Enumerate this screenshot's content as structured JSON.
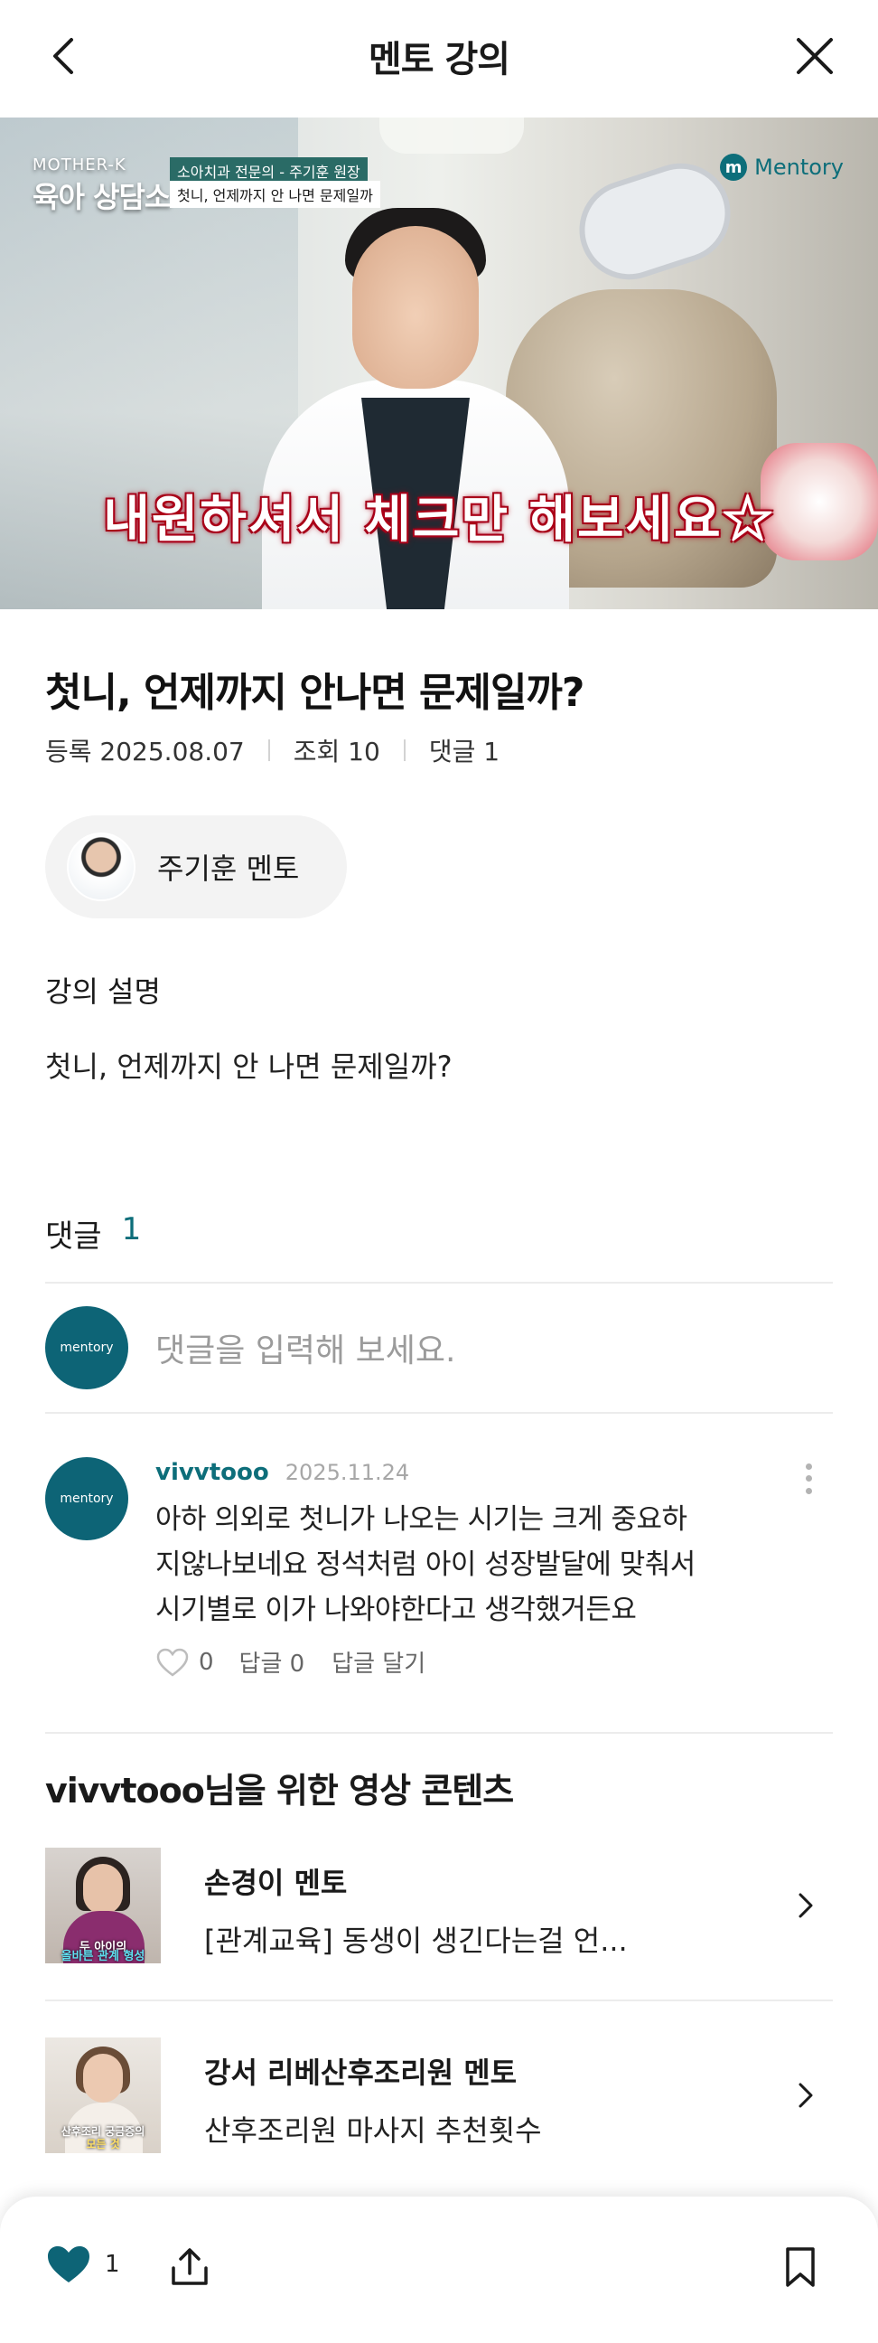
{
  "header": {
    "title": "멘토 강의"
  },
  "video": {
    "brand_small": "MOTHER-K",
    "brand_big": "육아 상담소",
    "caption_line1": "소아치과 전문의 - 주기훈 원장",
    "caption_line2": "첫니, 언제까지 안 나면 문제일까",
    "logo_text": "Mentory",
    "subtitle": "내원하셔서 체크만 해보세요☆"
  },
  "lecture": {
    "title": "첫니, 언제까지 안나면 문제일까?",
    "registered": "등록 2025.08.07",
    "views": "조회 10",
    "comments": "댓글 1"
  },
  "mentor": {
    "name": "주기훈 멘토"
  },
  "description": {
    "label": "강의 설명",
    "text": "첫니, 언제까지 안 나면 문제일까?"
  },
  "comments": {
    "label": "댓글",
    "count": "1",
    "input_placeholder": "댓글을 입력해 보세요.",
    "avatar_text": "mentory",
    "items": [
      {
        "user": "vivvtooo",
        "date": "2025.11.24",
        "lines": [
          "아하 의외로 첫니가 나오는 시기는 크게 중요하",
          "지않나보네요 정석처럼 아이 성장발달에 맞춰서",
          "시기별로 이가 나와야한다고 생각했거든요"
        ],
        "likes": "0",
        "replies": "답글 0",
        "reply_action": "답글 달기"
      }
    ]
  },
  "recommendations": {
    "title": "vivvtooo님을 위한 영상 콘텐츠",
    "items": [
      {
        "mentor": "손경이 멘토",
        "lecture": "[관계교육] 동생이 생긴다는걸 언...",
        "thumb_caption1": "두 아이의",
        "thumb_caption2": "올바른 관계 형성"
      },
      {
        "mentor": "강서 리베산후조리원 멘토",
        "lecture": "산후조리원 마사지 추천횟수",
        "thumb_caption1": "산후조리 궁금증의",
        "thumb_caption2": "모든 것"
      }
    ]
  },
  "bottom_bar": {
    "like_count": "1"
  },
  "colors": {
    "accent": "#0d6e7a",
    "heart": "#0d6476"
  }
}
